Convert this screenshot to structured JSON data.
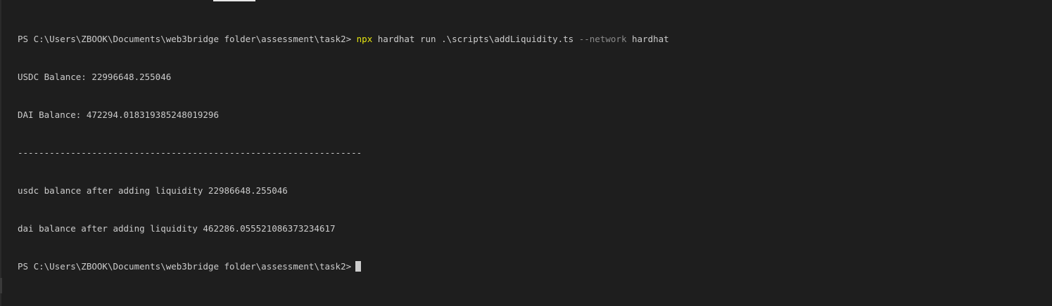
{
  "terminal": {
    "prompt": "PS C:\\Users\\ZBOOK\\Documents\\web3bridge folder\\assessment\\task2>",
    "command": {
      "executable": "npx",
      "args": " hardhat run .\\scripts\\addLiquidity.ts ",
      "flag": "--network",
      "flag_value": " hardhat"
    },
    "output_lines": [
      "USDC Balance: 22996648.255046",
      "DAI Balance: 472294.018319385248019296",
      "-----------------------------------------------------------------",
      "usdc balance after adding liquidity 22986648.255046",
      "dai balance after adding liquidity 462286.055521086373234617"
    ],
    "final_prompt": "PS C:\\Users\\ZBOOK\\Documents\\web3bridge folder\\assessment\\task2>"
  },
  "colors": {
    "background": "#1e1e1e",
    "text": "#cccccc",
    "executable": "#e5e510",
    "flag": "#8a8a8a"
  }
}
